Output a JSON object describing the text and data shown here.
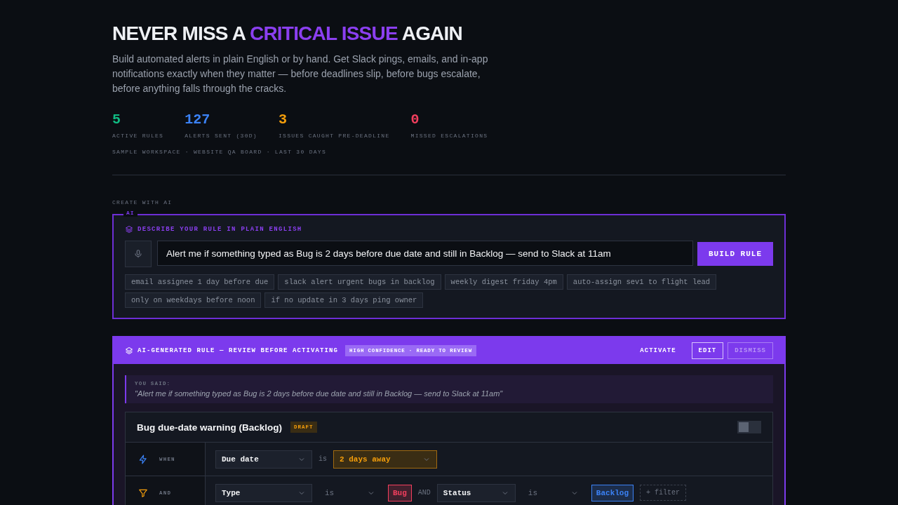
{
  "hero": {
    "title_before": "NEVER MISS A ",
    "title_highlight": "CRITICAL ISSUE",
    "title_after": " AGAIN",
    "description": "Build automated alerts in plain English or by hand. Get Slack pings, emails, and in-app notifications exactly when they matter — before deadlines slip, before bugs escalate, before anything falls through the cracks.",
    "stats": [
      {
        "value": "5",
        "label": "ACTIVE RULES",
        "color": "#10b981"
      },
      {
        "value": "127",
        "label": "ALERTS SENT (30D)",
        "color": "#3b82f6"
      },
      {
        "value": "3",
        "label": "ISSUES CAUGHT PRE-DEADLINE",
        "color": "#f59e0b"
      },
      {
        "value": "0",
        "label": "MISSED ESCALATIONS",
        "color": "#f43f5e"
      }
    ],
    "context": "SAMPLE WORKSPACE · WEBSITE QA BOARD · LAST 30 DAYS"
  },
  "create_ai": {
    "section_label": "CREATE WITH AI",
    "badge": "AI",
    "heading": "DESCRIBE YOUR RULE IN PLAIN ENGLISH",
    "input_value": "Alert me if something typed as Bug is 2 days before due date and still in Backlog — send to Slack at 11am",
    "button": "BUILD RULE",
    "suggestions": [
      "email assignee 1 day before due",
      "slack alert urgent bugs in backlog",
      "weekly digest friday 4pm",
      "auto-assign sev1 to flight lead",
      "only on weekdays before noon",
      "if no update in 3 days ping owner"
    ]
  },
  "generated": {
    "title": "AI-GENERATED RULE — REVIEW BEFORE ACTIVATING",
    "confidence": "HIGH CONFIDENCE · READY TO REVIEW",
    "actions": [
      {
        "label": "ACTIVATE",
        "kind": "text",
        "disabled": false
      },
      {
        "label": "EDIT",
        "kind": "outline",
        "disabled": false
      },
      {
        "label": "DISMISS",
        "kind": "outline",
        "disabled": true
      }
    ],
    "you_said_label": "YOU SAID:",
    "you_said": "\"Alert me if something typed as Bug is 2 days before due date and still in Backlog — send to Slack at 11am\"",
    "rule": {
      "name": "Bug due-date warning (Backlog)",
      "status": "DRAFT",
      "on": false,
      "rows": [
        {
          "kind": "trigger",
          "label": "WHEN",
          "parts": [
            {
              "kind": "select",
              "value": "Due date"
            },
            {
              "kind": "text",
              "value": "is"
            },
            {
              "kind": "select",
              "value": "2 days away",
              "highlight": true
            }
          ]
        },
        {
          "kind": "filter",
          "label": "AND",
          "parts": [
            {
              "kind": "select",
              "value": "Type"
            },
            {
              "kind": "select",
              "value": "is",
              "muted": true
            },
            {
              "kind": "tag",
              "value": "Bug",
              "color": "#f43f5e"
            },
            {
              "kind": "text",
              "value": "AND"
            },
            {
              "kind": "select",
              "value": "Status"
            },
            {
              "kind": "select",
              "value": "is",
              "muted": true
            },
            {
              "kind": "tag",
              "value": "Backlog",
              "color": "#3b82f6"
            },
            {
              "kind": "add",
              "value": "+ filter"
            }
          ]
        }
      ]
    }
  }
}
